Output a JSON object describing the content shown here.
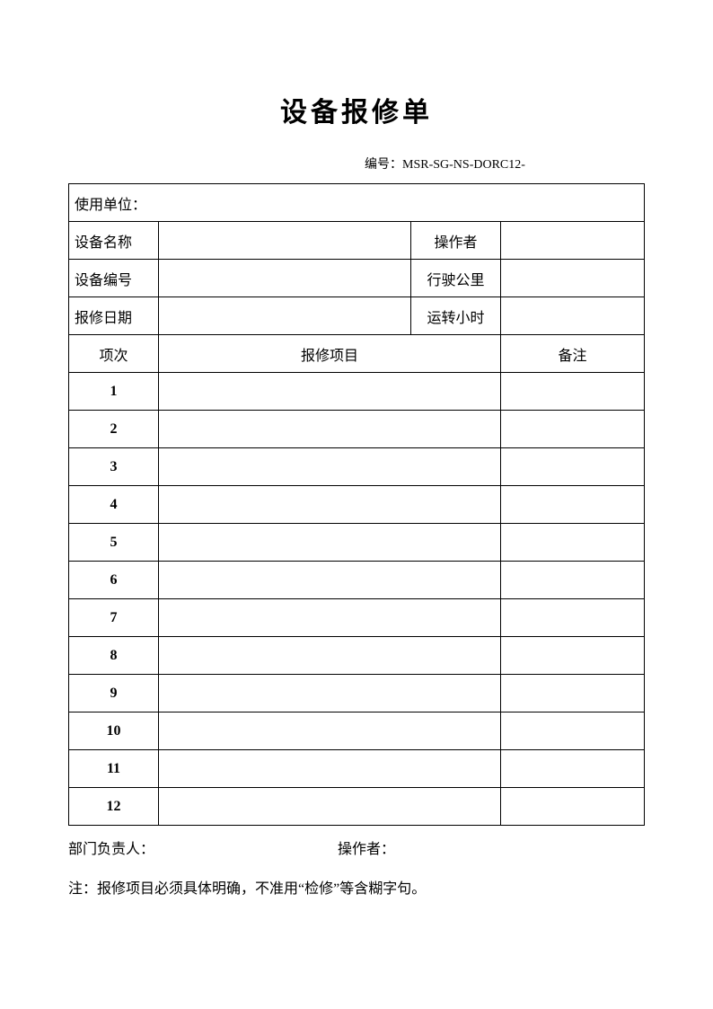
{
  "title": "设备报修单",
  "doc_number_label": "编号：MSR-SG-NS-DORC12-",
  "header": {
    "using_unit_label": "使用单位：",
    "equipment_name_label": "设备名称",
    "operator_label": "操作者",
    "equipment_number_label": "设备编号",
    "mileage_label": "行驶公里",
    "repair_date_label": "报修日期",
    "running_hours_label": "运转小时",
    "equipment_name_value": "",
    "operator_value": "",
    "equipment_number_value": "",
    "mileage_value": "",
    "repair_date_value": "",
    "running_hours_value": ""
  },
  "items_header": {
    "seq_label": "项次",
    "item_label": "报修项目",
    "remark_label": "备注"
  },
  "items": [
    {
      "seq": "1",
      "item": "",
      "remark": ""
    },
    {
      "seq": "2",
      "item": "",
      "remark": ""
    },
    {
      "seq": "3",
      "item": "",
      "remark": ""
    },
    {
      "seq": "4",
      "item": "",
      "remark": ""
    },
    {
      "seq": "5",
      "item": "",
      "remark": ""
    },
    {
      "seq": "6",
      "item": "",
      "remark": ""
    },
    {
      "seq": "7",
      "item": "",
      "remark": ""
    },
    {
      "seq": "8",
      "item": "",
      "remark": ""
    },
    {
      "seq": "9",
      "item": "",
      "remark": ""
    },
    {
      "seq": "10",
      "item": "",
      "remark": ""
    },
    {
      "seq": "11",
      "item": "",
      "remark": ""
    },
    {
      "seq": "12",
      "item": "",
      "remark": ""
    }
  ],
  "footer": {
    "dept_manager_label": "部门负责人：",
    "operator_label": "操作者：",
    "note": "注：报修项目必须具体明确，不准用“检修”等含糊字句。"
  }
}
